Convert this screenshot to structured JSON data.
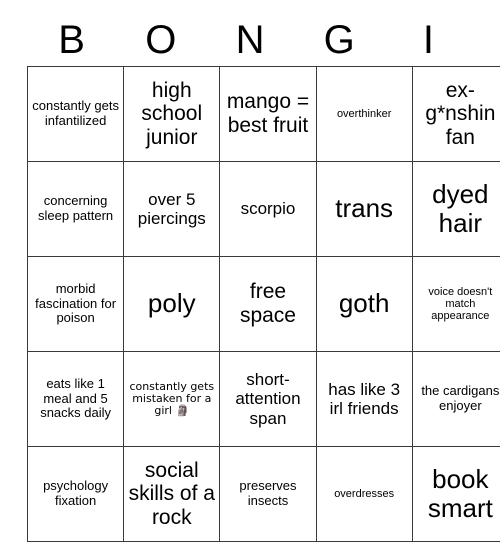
{
  "card": {
    "header_letters": [
      "B",
      "O",
      "N",
      "G",
      "I"
    ],
    "rows": [
      [
        {
          "text": "constantly gets infantilized",
          "size": "fs-s"
        },
        {
          "text": "high school junior",
          "size": "fs-l"
        },
        {
          "text": "mango = best fruit",
          "size": "fs-l"
        },
        {
          "text": "overthinker",
          "size": "fs-xs"
        },
        {
          "text": "ex-g*nshin fan",
          "size": "fs-l"
        }
      ],
      [
        {
          "text": "concerning sleep pattern",
          "size": "fs-s"
        },
        {
          "text": "over 5 piercings",
          "size": "fs-m"
        },
        {
          "text": "scorpio",
          "size": "fs-m"
        },
        {
          "text": "trans",
          "size": "fs-xl"
        },
        {
          "text": "dyed hair",
          "size": "fs-xl"
        }
      ],
      [
        {
          "text": "morbid fascination for poison",
          "size": "fs-s"
        },
        {
          "text": "poly",
          "size": "fs-xl"
        },
        {
          "text": "free space",
          "size": "fs-l"
        },
        {
          "text": "goth",
          "size": "fs-xl"
        },
        {
          "text": "voice doesn't match appearance",
          "size": "fs-xs"
        }
      ],
      [
        {
          "text": "eats like 1 meal and 5 snacks daily",
          "size": "fs-s"
        },
        {
          "text": "constantly gets mistaken for a girl 🗿",
          "size": "fs-xs"
        },
        {
          "text": "short-attention span",
          "size": "fs-m"
        },
        {
          "text": "has like 3 irl friends",
          "size": "fs-m"
        },
        {
          "text": "the cardigans enjoyer",
          "size": "fs-s"
        }
      ],
      [
        {
          "text": "psychology fixation",
          "size": "fs-s"
        },
        {
          "text": "social skills of a rock",
          "size": "fs-l"
        },
        {
          "text": "preserves insects",
          "size": "fs-s"
        },
        {
          "text": "overdresses",
          "size": "fs-xs"
        },
        {
          "text": "book smart",
          "size": "fs-xl"
        }
      ]
    ]
  },
  "colors": {
    "background": "#ffffff",
    "text": "#000000",
    "grid_line": "#3a3a3a"
  }
}
